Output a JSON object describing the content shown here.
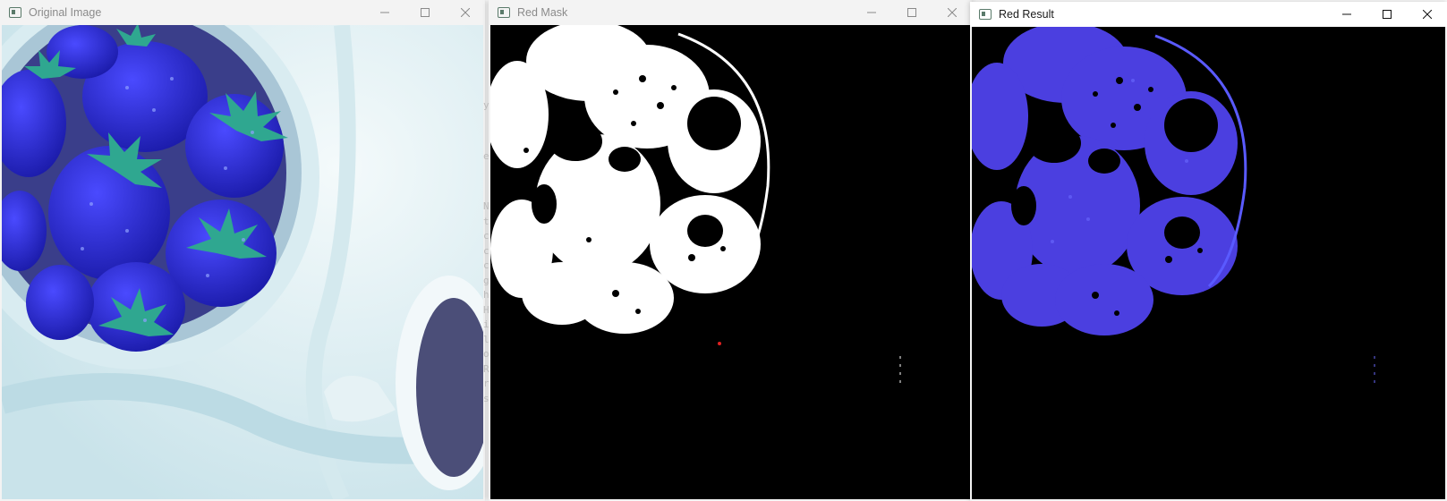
{
  "windows": {
    "original": {
      "title": "Original Image"
    },
    "mask": {
      "title": "Red Mask"
    },
    "result": {
      "title": "Red Result"
    }
  },
  "controls": {
    "minimize": "—",
    "maximize": "☐",
    "close": "✕"
  },
  "background_console_chars": [
    "y",
    "e",
    "N",
    "t",
    "c",
    "c",
    "c",
    "g",
    "h",
    "H",
    "i",
    "l",
    "o",
    "R",
    "r",
    "s"
  ],
  "colors": {
    "titlebar": "#f3f3f3",
    "berry": "#2a2ad8",
    "leaf": "#2fa790",
    "bowl": "#dfeff3",
    "mask_fg": "#ffffff",
    "mask_bg": "#000000",
    "result_berry": "#4b3fe0"
  },
  "icons": [
    "app-icon",
    "minimize-icon",
    "maximize-icon",
    "close-icon"
  ]
}
